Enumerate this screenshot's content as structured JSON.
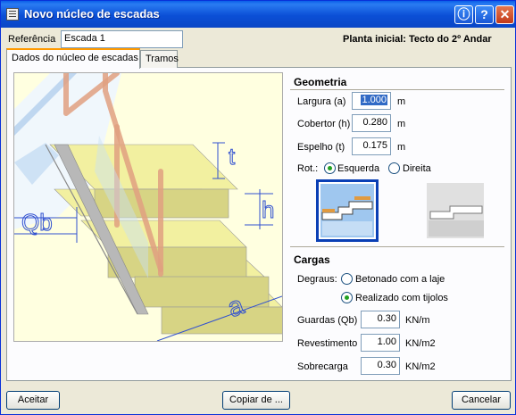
{
  "window": {
    "title": "Novo núcleo de escadas",
    "title_buttons": [
      "info-icon",
      "help-icon",
      "close-icon"
    ]
  },
  "header": {
    "referencia_label": "Referência",
    "referencia_value": "Escada 1",
    "planta_inicial": "Planta inicial: Tecto do 2º Andar"
  },
  "tabs": [
    {
      "label": "Dados do núcleo de escadas",
      "active": true
    },
    {
      "label": "Tramos",
      "active": false
    }
  ],
  "diagram": {
    "labels": {
      "t": "t",
      "h": "h",
      "qb": "Qb",
      "a": "a"
    }
  },
  "geometria": {
    "title": "Geometria",
    "largura": {
      "label": "Largura (a)",
      "value": "1.000",
      "unit": "m"
    },
    "cobertor": {
      "label": "Cobertor (h)",
      "value": "0.280",
      "unit": "m"
    },
    "espelho": {
      "label": "Espelho (t)",
      "value": "0.175",
      "unit": "m"
    },
    "rot": {
      "label": "Rot.:",
      "options": [
        "Esquerda",
        "Direita"
      ],
      "selected": "Esquerda"
    }
  },
  "cargas": {
    "title": "Cargas",
    "degraus_label": "Degraus:",
    "degraus_options": [
      "Betonado com a laje",
      "Realizado com tijolos"
    ],
    "degraus_selected": "Realizado com tijolos",
    "guardas": {
      "label": "Guardas (Qb)",
      "value": "0.30",
      "unit": "KN/m"
    },
    "revestimento": {
      "label": "Revestimento",
      "value": "1.00",
      "unit": "KN/m2"
    },
    "sobrecarga": {
      "label": "Sobrecarga",
      "value": "0.30",
      "unit": "KN/m2"
    }
  },
  "footer": {
    "aceitar": "Aceitar",
    "copiar": "Copiar de ...",
    "cancelar": "Cancelar"
  },
  "colors": {
    "title_bar": "#0b4fd6",
    "dialog_bg": "#ece9d8",
    "selection": "#316ac5",
    "radio_dot": "#21a121",
    "tab_accent": "#ff9a00",
    "diagram_bg": "#ffffe0",
    "stair": "#f2f0a0",
    "rail": "#e0a080",
    "dimension": "#3050d0"
  }
}
